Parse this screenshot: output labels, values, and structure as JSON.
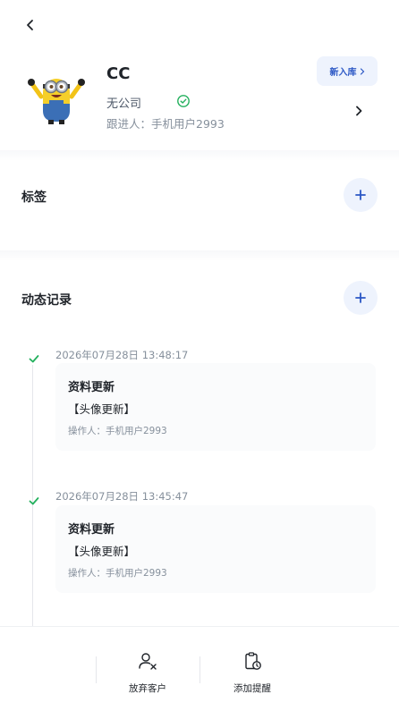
{
  "header": {
    "back_icon": "chevron-left-icon"
  },
  "profile": {
    "name": "CC",
    "company": "无公司",
    "follower_label": "跟进人：",
    "follower_name": "手机用户2993",
    "new_button_label": "新入库",
    "verified_icon": "check-circle-icon"
  },
  "tags": {
    "title": "标签",
    "add_icon": "plus-icon"
  },
  "activity": {
    "title": "动态记录",
    "add_icon": "plus-icon",
    "entries": [
      {
        "time": "2026年07月28日 13:48:17",
        "title": "资料更新",
        "body": "【头像更新】",
        "operator": "操作人：手机用户2993"
      },
      {
        "time": "2026年07月28日 13:45:47",
        "title": "资料更新",
        "body": "【头像更新】",
        "operator": "操作人：手机用户2993"
      }
    ]
  },
  "bottom_bar": {
    "actions": [
      {
        "label": "放弃客户",
        "icon": "user-remove-icon"
      },
      {
        "label": "添加提醒",
        "icon": "clipboard-clock-icon"
      }
    ]
  },
  "colors": {
    "accent": "#2b57c5",
    "success": "#23b05d",
    "soft_blue": "#eef3fd"
  }
}
